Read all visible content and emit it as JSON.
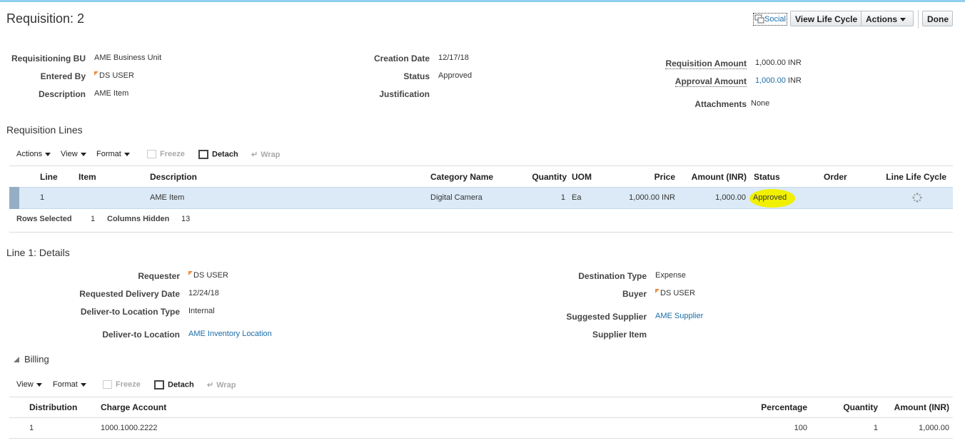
{
  "header": {
    "title": "Requisition: 2",
    "social_label": "Social",
    "view_life_cycle": "View Life Cycle",
    "actions": "Actions",
    "done": "Done"
  },
  "summary": {
    "req_bu_label": "Requisitioning BU",
    "req_bu": "AME Business Unit",
    "entered_by_label": "Entered By",
    "entered_by": "DS USER",
    "description_label": "Description",
    "description": "AME Item",
    "creation_date_label": "Creation Date",
    "creation_date": "12/17/18",
    "status_label": "Status",
    "status": "Approved",
    "justification_label": "Justification",
    "req_amount_label": "Requisition Amount",
    "req_amount": "1,000.00 INR",
    "approval_amount_label": "Approval Amount",
    "approval_amount": "1,000.00",
    "approval_currency": "INR",
    "attachments_label": "Attachments",
    "attachments": "None"
  },
  "lines": {
    "title": "Requisition Lines",
    "toolbar": {
      "actions": "Actions",
      "view": "View",
      "format": "Format",
      "freeze": "Freeze",
      "detach": "Detach",
      "wrap": "Wrap"
    },
    "columns": [
      "Line",
      "Item",
      "Description",
      "Category Name",
      "Quantity",
      "UOM",
      "Price",
      "Amount (INR)",
      "Status",
      "Order",
      "Line Life Cycle"
    ],
    "row": {
      "line": "1",
      "item": "",
      "description": "AME Item",
      "category": "Digital Camera",
      "quantity": "1",
      "uom": "Ea",
      "price": "1,000.00 INR",
      "amount": "1,000.00",
      "status": "Approved",
      "order": ""
    },
    "rows_selected_label": "Rows Selected",
    "rows_selected": "1",
    "columns_hidden_label": "Columns Hidden",
    "columns_hidden": "13",
    "highlight_color": "#f0f000"
  },
  "details": {
    "title": "Line 1: Details",
    "requester_label": "Requester",
    "requester": "DS USER",
    "delivery_date_label": "Requested Delivery Date",
    "delivery_date": "12/24/18",
    "loc_type_label": "Deliver-to Location Type",
    "loc_type": "Internal",
    "location_label": "Deliver-to Location",
    "location": "AME Inventory Location",
    "dest_type_label": "Destination Type",
    "dest_type": "Expense",
    "buyer_label": "Buyer",
    "buyer": "DS USER",
    "supplier_label": "Suggested Supplier",
    "supplier": "AME Supplier",
    "supplier_item_label": "Supplier Item"
  },
  "billing": {
    "title": "Billing",
    "toolbar": {
      "view": "View",
      "format": "Format",
      "freeze": "Freeze",
      "detach": "Detach",
      "wrap": "Wrap"
    },
    "columns": [
      "Distribution",
      "Charge Account",
      "Percentage",
      "Quantity",
      "Amount (INR)"
    ],
    "row": {
      "distribution": "1",
      "account": "1000.1000.2222",
      "percentage": "100",
      "quantity": "1",
      "amount": "1,000.00"
    }
  }
}
